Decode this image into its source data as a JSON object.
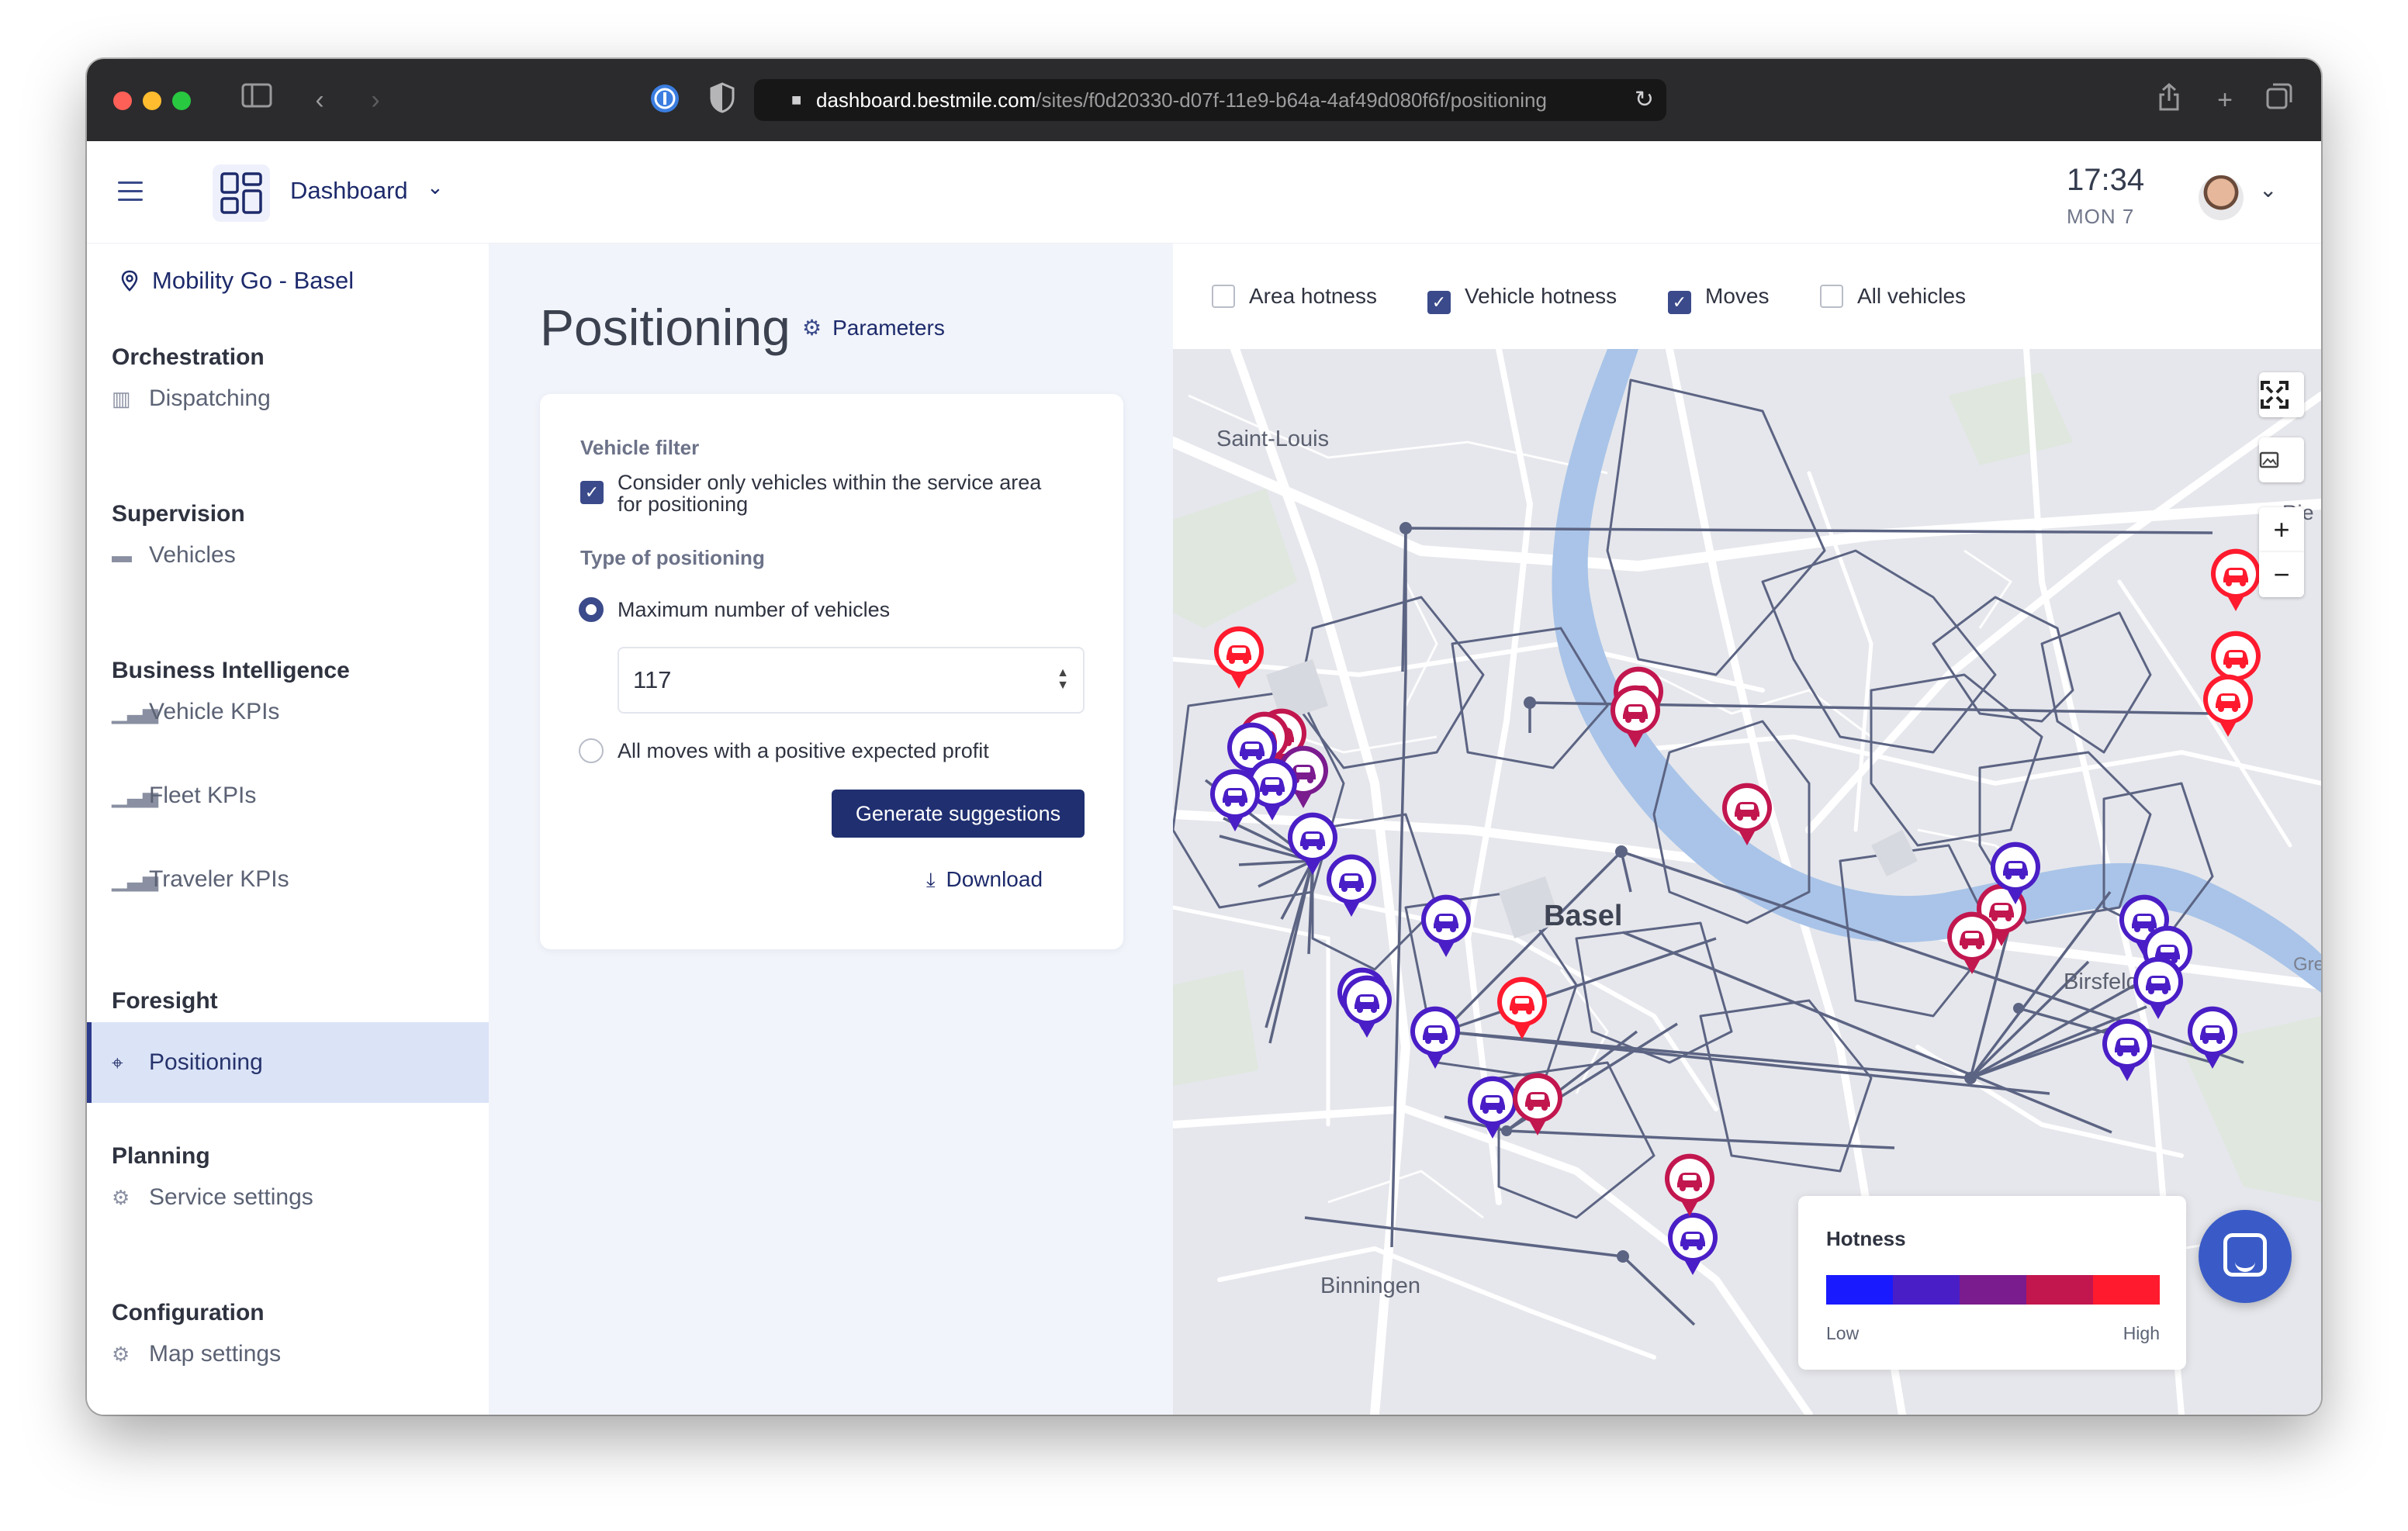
{
  "browser": {
    "url_host": "dashboard.bestmile.com",
    "url_path": "/sites/f0d20330-d07f-11e9-b64a-4af49d080f6f/positioning"
  },
  "header": {
    "app_title": "Dashboard",
    "time": "17:34",
    "day": "MON 7"
  },
  "sidebar": {
    "site": "Mobility Go - Basel",
    "sections": {
      "orchestration": "Orchestration",
      "supervision": "Supervision",
      "business_intelligence": "Business Intelligence",
      "foresight": "Foresight",
      "planning": "Planning",
      "configuration": "Configuration"
    },
    "items": {
      "dispatching": "Dispatching",
      "vehicles": "Vehicles",
      "vehicle_kpis": "Vehicle KPIs",
      "fleet_kpis": "Fleet KPIs",
      "traveler_kpis": "Traveler KPIs",
      "positioning": "Positioning",
      "service_settings": "Service settings",
      "map_settings": "Map settings"
    }
  },
  "page": {
    "title": "Positioning",
    "parameters_link": "Parameters"
  },
  "form": {
    "vehicle_filter_label": "Vehicle filter",
    "service_area_line1": "Consider only vehicles within the service area",
    "service_area_line2": "for positioning",
    "service_area_checked": true,
    "type_label": "Type of positioning",
    "option_max": "Maximum number of vehicles",
    "max_value": "117",
    "option_profit": "All moves with a positive expected profit",
    "selected_option": "max",
    "generate_button": "Generate suggestions",
    "download_link": "Download"
  },
  "layers": {
    "area_hotness": {
      "label": "Area hotness",
      "checked": false
    },
    "vehicle_hotness": {
      "label": "Vehicle hotness",
      "checked": true
    },
    "moves": {
      "label": "Moves",
      "checked": true
    },
    "all_vehicles": {
      "label": "All vehicles",
      "checked": false
    }
  },
  "map": {
    "place_labels": {
      "saint_louis": "Saint-Louis",
      "basel": "Basel",
      "birsfelden": "Birsfelden",
      "binningen": "Binningen",
      "gre": "Gre",
      "rie": "Rie"
    },
    "controls": {
      "zoom_in": "+",
      "zoom_out": "−"
    }
  },
  "legend": {
    "title": "Hotness",
    "low": "Low",
    "high": "High",
    "colors": [
      "#1a1aff",
      "#4a1ec6",
      "#7a1b8e",
      "#c2164f",
      "#ff1a2e"
    ]
  },
  "colors": {
    "accent": "#1f2f70",
    "cold_vehicle": "#7a1b8e",
    "hot_vehicle": "#ff1a2e"
  }
}
